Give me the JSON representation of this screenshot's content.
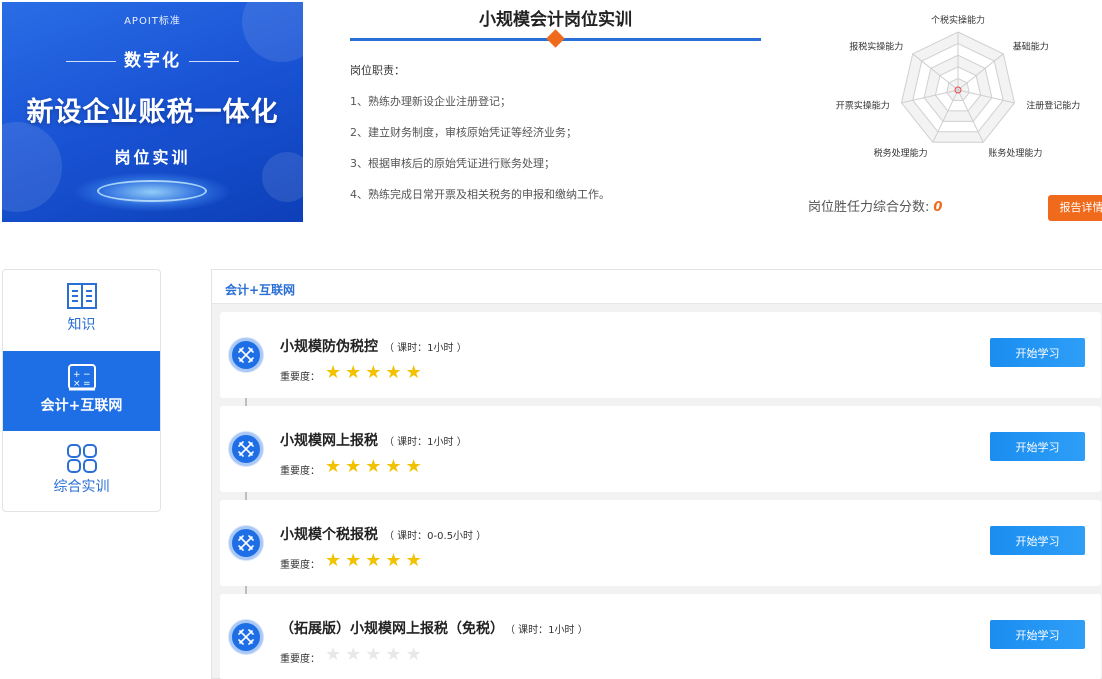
{
  "banner": {
    "standard": "APOIT标准",
    "digital": "数字化",
    "title": "新设企业账税一体化",
    "subtitle": "岗位实训"
  },
  "job": {
    "title": "小规模会计岗位实训",
    "duty_label": "岗位职责：",
    "duties": [
      "1、熟练办理新设企业注册登记；",
      "2、建立财务制度，审核原始凭证等经济业务；",
      "3、根据审核后的原始凭证进行账务处理；",
      "4、熟练完成日常开票及相关税务的申报和缴纳工作。"
    ]
  },
  "radar": {
    "axes": [
      "个税实操能力",
      "基础能力",
      "注册登记能力",
      "账务处理能力",
      "税务处理能力",
      "开票实操能力",
      "报税实操能力"
    ]
  },
  "score": {
    "label": "岗位胜任力综合分数:",
    "value": "0",
    "report_button": "报告详情"
  },
  "nav": {
    "items": [
      {
        "label": "知识"
      },
      {
        "label": "会计+互联网"
      },
      {
        "label": "综合实训"
      }
    ]
  },
  "panel": {
    "header": "会计+互联网",
    "courses": [
      {
        "title": "小规模防伪税控",
        "hours": "（ 课时：1小时 ）",
        "importance_label": "重要度：",
        "importance": 5,
        "button": "开始学习"
      },
      {
        "title": "小规模网上报税",
        "hours": "（ 课时：1小时 ）",
        "importance_label": "重要度：",
        "importance": 5,
        "button": "开始学习"
      },
      {
        "title": "小规模个税报税",
        "hours": "（ 课时：0-0.5小时 ）",
        "importance_label": "重要度：",
        "importance": 5,
        "button": "开始学习"
      },
      {
        "title": "（拓展版）小规模网上报税（免税）",
        "hours": "（ 课时：1小时 ）",
        "importance_label": "重要度：",
        "importance": 0,
        "button": "开始学习"
      }
    ]
  },
  "colors": {
    "primary": "#1e6ee6",
    "accent": "#f06a1c",
    "star": "#f2c200"
  }
}
